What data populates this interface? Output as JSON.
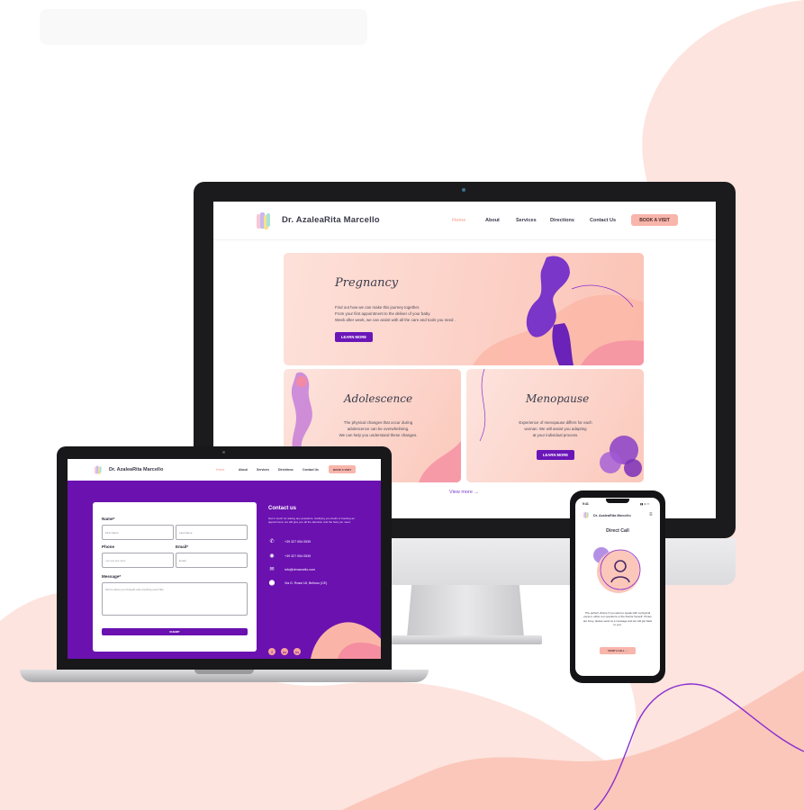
{
  "colors": {
    "brand_purple": "#6a11b0",
    "accent_pink": "#f8b5ab",
    "blob_peach": "#fbc7bb",
    "blob_light": "#fde4de"
  },
  "desktop": {
    "brand": "Dr. AzaleaRita Marcello",
    "nav": [
      "Home",
      "About",
      "Services",
      "Directions",
      "Contact Us"
    ],
    "cta": "BOOK A VISIT",
    "cards": {
      "pregnancy": {
        "title": "Pregnancy",
        "lines": [
          "Find out how we can make this journey together.",
          "From your first appointment to the deliver of your baby.",
          "Week after week, we can assist with all the care and tools you need ."
        ],
        "button": "LEARN MORE"
      },
      "adolescence": {
        "title": "Adolescence",
        "lines": [
          "The physical changes that occur during",
          "adolescence can be overwhelming.",
          "We can help you understand these changes."
        ]
      },
      "menopause": {
        "title": "Menopause",
        "lines": [
          "Experience of menopause differs for each",
          "woman. We will assist you adapting",
          "at your individual process."
        ],
        "button": "LEARN MORE"
      }
    },
    "view_more": "View more →"
  },
  "laptop": {
    "brand": "Dr. AzaleaRita Marcello",
    "nav": [
      "Home",
      "About",
      "Services",
      "Directions",
      "Contact Us"
    ],
    "cta": "BOOK A VISIT",
    "form": {
      "name_label": "Name*",
      "first_placeholder": "First Name",
      "last_placeholder": "Last Name",
      "phone_label": "Phone",
      "phone_placeholder": "+xx xxx xxx xxxx",
      "email_label": "Email*",
      "email_placeholder": "Email",
      "message_label": "Message*",
      "message_placeholder": "Tell us about you thought and anything you'd like",
      "submit": "SUBMIT"
    },
    "contact": {
      "title": "Contact us",
      "description": "Get in touch for asking any questions, clarifying you doubt or booking an appointment, we will give you all the attention and the help you need.",
      "phone1": "+39 327 054 0539",
      "phone2": "+39 327 054 0539",
      "email": "info@drmarcello.com",
      "address": "Via G. Rossi 18, Belluno (CE)",
      "social": [
        "f",
        "in",
        "in"
      ]
    }
  },
  "phone": {
    "time": "9:41",
    "status": "▮▮ ≋ ▭",
    "brand": "Dr. AzaleaRita Marcello",
    "menu_icon": "≡",
    "heading": "Direct Call",
    "description": "The perfect choice if you want to speak with a physical person, either our operators or the Doctor herself. If lines are busy, please send us a message and we will get back to you.",
    "button": "START A CALL →"
  }
}
